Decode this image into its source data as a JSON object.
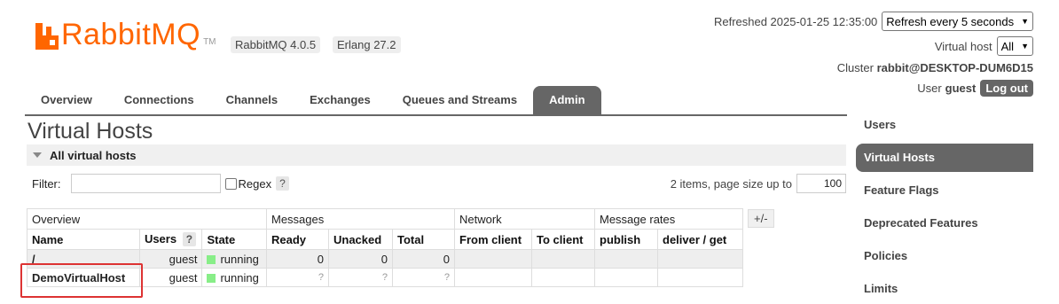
{
  "header": {
    "brand": "RabbitMQ",
    "tm": "TM",
    "version": "RabbitMQ 4.0.5",
    "erlang": "Erlang 27.2",
    "refreshed": "Refreshed 2025-01-25 12:35:00",
    "refresh_select": "Refresh every 5 seconds",
    "vhost_label": "Virtual host",
    "vhost_select": "All",
    "cluster_label": "Cluster",
    "cluster_name": "rabbit@DESKTOP-DUM6D15",
    "user_label": "User",
    "user_name": "guest",
    "logout": "Log out"
  },
  "tabs": [
    {
      "label": "Overview"
    },
    {
      "label": "Connections"
    },
    {
      "label": "Channels"
    },
    {
      "label": "Exchanges"
    },
    {
      "label": "Queues and Streams"
    },
    {
      "label": "Admin",
      "active": true
    }
  ],
  "sidebar": [
    {
      "label": "Users"
    },
    {
      "label": "Virtual Hosts",
      "active": true
    },
    {
      "label": "Feature Flags"
    },
    {
      "label": "Deprecated Features"
    },
    {
      "label": "Policies"
    },
    {
      "label": "Limits"
    }
  ],
  "main": {
    "title": "Virtual Hosts",
    "section": "All virtual hosts",
    "filter_label": "Filter:",
    "regex_label": "Regex",
    "help": "?",
    "paging_text": "2 items, page size up to",
    "page_size": "100",
    "plus_minus": "+/-"
  },
  "table": {
    "groups": [
      "Overview",
      "Messages",
      "Network",
      "Message rates"
    ],
    "columns": [
      "Name",
      "Users",
      "State",
      "Ready",
      "Unacked",
      "Total",
      "From client",
      "To client",
      "publish",
      "deliver / get"
    ],
    "users_help": "?",
    "rows": [
      {
        "name": "/",
        "users": "guest",
        "state": "running",
        "ready": "0",
        "unacked": "0",
        "total": "0",
        "from_client": "",
        "to_client": "",
        "publish": "",
        "deliver": ""
      },
      {
        "name": "DemoVirtualHost",
        "users": "guest",
        "state": "running",
        "ready": "?",
        "unacked": "?",
        "total": "?",
        "from_client": "",
        "to_client": "",
        "publish": "",
        "deliver": ""
      }
    ]
  },
  "colors": {
    "brand": "#ff6600",
    "accent": "#666666",
    "running": "#88ee88",
    "highlight": "#dd3333"
  }
}
